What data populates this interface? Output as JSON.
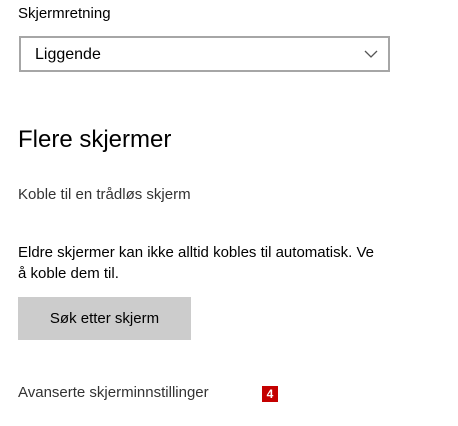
{
  "orientation": {
    "label": "Skjermretning",
    "selected": "Liggende"
  },
  "multiple_displays": {
    "heading": "Flere skjermer",
    "connect_wireless_link": "Koble til en trådløs skjerm",
    "info_line_1": "Eldre skjermer kan ikke alltid kobles til automatisk. Ve",
    "info_line_2": "å koble dem til.",
    "detect_button": "Søk etter skjerm"
  },
  "advanced": {
    "link": "Avanserte skjerminnstillinger",
    "badge": "4"
  },
  "colors": {
    "badge": "#c40000",
    "button_bg": "#cccccc",
    "dropdown_border": "#a6a6a6"
  }
}
